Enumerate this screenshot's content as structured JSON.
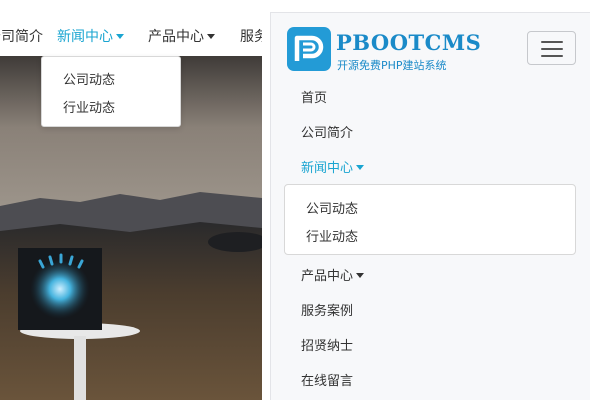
{
  "top_nav": {
    "items": [
      {
        "label": "公司简介"
      },
      {
        "label": "新闻中心",
        "active": true,
        "has_dropdown": true
      },
      {
        "label": "产品中心",
        "has_dropdown": true
      },
      {
        "label": "服务案例"
      }
    ],
    "dropdown": [
      "公司动态",
      "行业动态"
    ]
  },
  "mobile": {
    "logo_title": "PBOOTCMS",
    "logo_subtitle": "开源免费PHP建站系统",
    "toggler_icon": "hamburger-menu-icon",
    "menu": [
      {
        "label": "首页"
      },
      {
        "label": "公司简介"
      },
      {
        "label": "新闻中心",
        "active": true,
        "has_dropdown": true
      },
      {
        "label": "产品中心",
        "has_dropdown": true
      },
      {
        "label": "服务案例"
      },
      {
        "label": "招贤纳士"
      },
      {
        "label": "在线留言"
      }
    ],
    "dropdown": [
      "公司动态",
      "行业动态"
    ]
  },
  "colors": {
    "accent": "#1aa5d1",
    "logo_blue": "#239bd6",
    "text": "#333333"
  }
}
